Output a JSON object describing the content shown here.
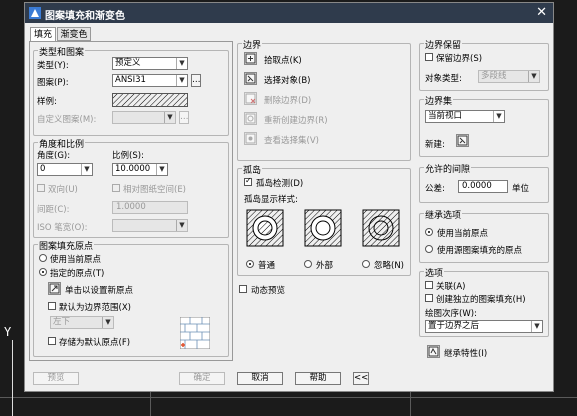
{
  "screen": {
    "axis_label": "Y"
  },
  "title": "图案填充和渐变色",
  "tabs": [
    {
      "label": "填充"
    },
    {
      "label": "渐变色"
    }
  ],
  "type_pattern": {
    "title": "类型和图案",
    "type_label": "类型(Y):",
    "type_value": "预定义",
    "pattern_label": "图案(P):",
    "pattern_value": "ANSI31",
    "sample_label": "样例:",
    "custom_label": "自定义图案(M):"
  },
  "angle_scale": {
    "title": "角度和比例",
    "angle_label": "角度(G):",
    "angle_value": "0",
    "scale_label": "比例(S):",
    "scale_value": "10.0000",
    "bidirectional_label": "双向(U)",
    "relative_label": "相对图纸空间(E)",
    "spacing_label": "间距(C):",
    "spacing_value": "1.0000",
    "iso_label": "ISO 笔宽(O):"
  },
  "origin": {
    "title": "图案填充原点",
    "use_current": "使用当前原点",
    "specified": "指定的原点(T)",
    "click_set": "单击以设置新原点",
    "default_extent": "默认为边界范围(X)",
    "position_value": "左下",
    "store_default": "存储为默认原点(F)"
  },
  "boundary": {
    "title": "边界",
    "add_pick": "拾取点(K)",
    "add_select": "选择对象(B)",
    "remove": "删除边界(D)",
    "recreate": "重新创建边界(R)",
    "view": "查看选择集(V)"
  },
  "islands": {
    "title": "孤岛",
    "detect": "孤岛检测(D)",
    "style_label": "孤岛显示样式:",
    "normal": "普通",
    "outer": "外部",
    "ignore": "忽略(N)"
  },
  "dynamic_preview": "动态预览",
  "retain": {
    "title": "边界保留",
    "retain_label": "保留边界(S)",
    "type_label": "对象类型:",
    "type_value": "多段线"
  },
  "boundary_set": {
    "title": "边界集",
    "value": "当前视口",
    "new_label": "新建:"
  },
  "gap": {
    "title": "允许的间隙",
    "tolerance_label": "公差:",
    "tolerance_value": "0.0000",
    "unit": "单位"
  },
  "inherit_options": {
    "title": "继承选项",
    "use_current": "使用当前原点",
    "use_source": "使用源图案填充的原点"
  },
  "options": {
    "title": "选项",
    "associative": "关联(A)",
    "separate": "创建独立的图案填充(H)",
    "draw_order_label": "绘图次序(W):",
    "draw_order_value": "置于边界之后"
  },
  "inherit_button": "继承特性(I)",
  "footer": {
    "preview": "预览",
    "ok": "确定",
    "cancel": "取消",
    "help": "帮助",
    "collapse": "<<"
  }
}
